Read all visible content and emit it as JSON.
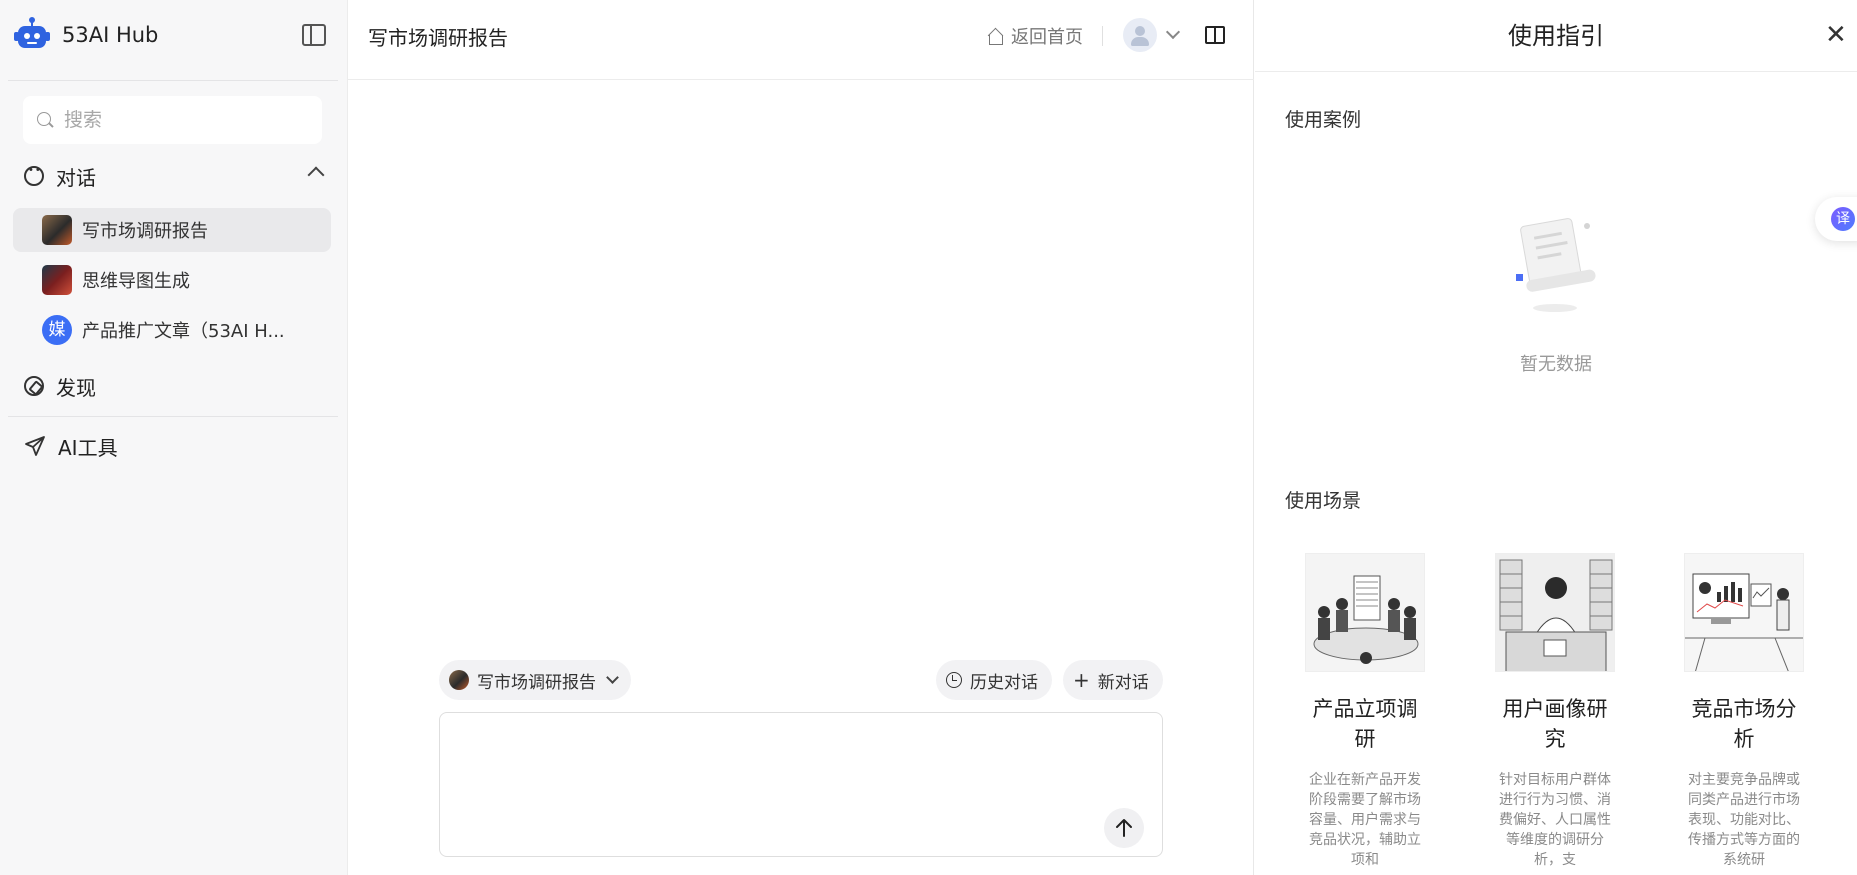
{
  "app": {
    "brand_name": "53AI Hub",
    "accent_color": "#4c6ef5"
  },
  "sidebar": {
    "search": {
      "placeholder": "搜索",
      "value": ""
    },
    "sections": {
      "chat_label": "对话",
      "discover_label": "发现",
      "ai_tools_label": "AI工具"
    },
    "conversations": [
      {
        "label": "写市场调研报告",
        "active": true,
        "thumb_color": "#3a3a3a"
      },
      {
        "label": "思维导图生成",
        "active": false,
        "thumb_color": "#6b2d2d"
      },
      {
        "label": "产品推广文章（53AI H...",
        "active": false,
        "thumb_color": "#3b6ef5",
        "thumb_char": "媒"
      }
    ]
  },
  "header": {
    "title": "写市场调研报告",
    "home_link": "返回首页"
  },
  "composer": {
    "agent_selector": "写市场调研报告",
    "history_button": "历史对话",
    "new_chat_button": "新对话",
    "input_value": "",
    "send_icon": "arrow-up"
  },
  "guide": {
    "title": "使用指引",
    "cases_heading": "使用案例",
    "empty_text": "暂无数据",
    "scenarios_heading": "使用场景",
    "scenarios": [
      {
        "name_line1": "产品立项调",
        "name_line2": "研",
        "desc": "企业在新产品开发阶段需要了解市场容量、用户需求与竞品状况，辅助立项和"
      },
      {
        "name_line1": "用户画像研",
        "name_line2": "究",
        "desc": "针对目标用户群体进行行为习惯、消费偏好、人口属性等维度的调研分析，支"
      },
      {
        "name_line1": "竞品市场分",
        "name_line2": "析",
        "desc": "对主要竞争品牌或同类产品进行市场表现、功能对比、传播方式等方面的系统研"
      }
    ]
  },
  "fab": {
    "translate_char": "译"
  }
}
